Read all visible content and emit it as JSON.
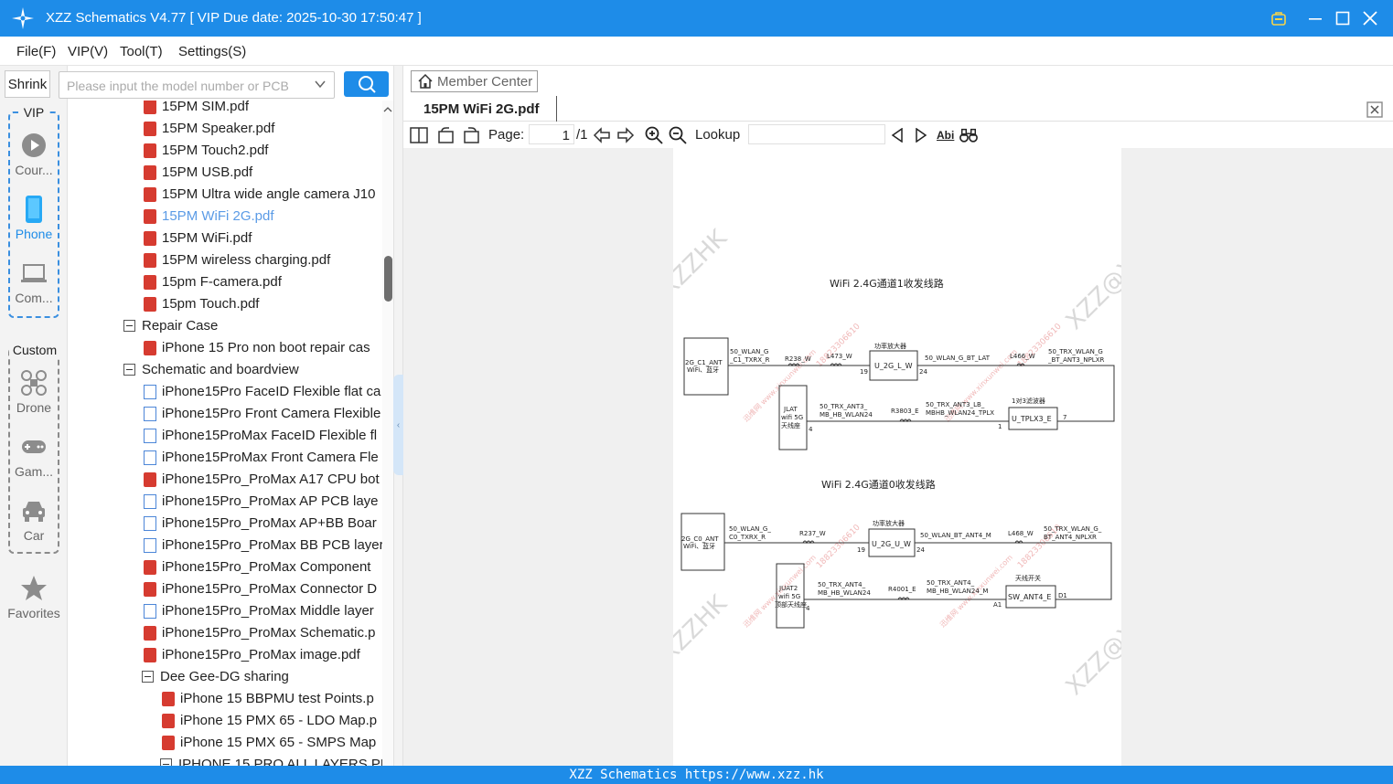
{
  "window": {
    "title": "XZZ Schematics V4.77 [ VIP Due date: 2025-10-30 17:50:47 ]",
    "icons": [
      "logo-icon",
      "vip-badge-icon",
      "minimize-icon",
      "maximize-icon",
      "close-icon"
    ]
  },
  "menu": [
    "File(F)",
    "VIP(V)",
    "Tool(T)",
    "Settings(S)"
  ],
  "sidebar": {
    "shrink_label": "Shrink",
    "vip_label": "VIP",
    "custom_label": "Custom",
    "vip_items": [
      {
        "label": "Cour...",
        "icon": "play-icon"
      },
      {
        "label": "Phone",
        "icon": "phone-icon"
      },
      {
        "label": "Com...",
        "icon": "laptop-icon"
      }
    ],
    "custom_items": [
      {
        "label": "Drone",
        "icon": "drone-icon"
      },
      {
        "label": "Gam...",
        "icon": "gamepad-icon"
      },
      {
        "label": "Car",
        "icon": "car-icon"
      }
    ],
    "favorites_label": "Favorites"
  },
  "search": {
    "placeholder": "Please input the model number or PCB"
  },
  "tree": [
    {
      "text": "15PM SIM.pdf",
      "type": "pdf",
      "indent": 1
    },
    {
      "text": "15PM Speaker.pdf",
      "type": "pdf",
      "indent": 1
    },
    {
      "text": "15PM Touch2.pdf",
      "type": "pdf",
      "indent": 1
    },
    {
      "text": "15PM USB.pdf",
      "type": "pdf",
      "indent": 1
    },
    {
      "text": "15PM Ultra wide angle camera J10",
      "type": "pdf",
      "indent": 1
    },
    {
      "text": "15PM WiFi 2G.pdf",
      "type": "pdf",
      "indent": 1,
      "selected": true
    },
    {
      "text": "15PM WiFi.pdf",
      "type": "pdf",
      "indent": 1
    },
    {
      "text": "15PM wireless charging.pdf",
      "type": "pdf",
      "indent": 1
    },
    {
      "text": "15pm F-camera.pdf",
      "type": "pdf",
      "indent": 1
    },
    {
      "text": "15pm Touch.pdf",
      "type": "pdf",
      "indent": 1
    },
    {
      "text": "Repair Case",
      "type": "folder",
      "indent": 0
    },
    {
      "text": "iPhone 15 Pro non boot repair cas",
      "type": "pdf",
      "indent": 1
    },
    {
      "text": "Schematic and boardview",
      "type": "folder",
      "indent": 0
    },
    {
      "text": "iPhone15Pro FaceID Flexible flat ca",
      "type": "doc",
      "indent": 1
    },
    {
      "text": "iPhone15Pro Front Camera Flexible",
      "type": "doc",
      "indent": 1
    },
    {
      "text": "iPhone15ProMax FaceID Flexible fl",
      "type": "doc",
      "indent": 1
    },
    {
      "text": "iPhone15ProMax Front Camera Fle",
      "type": "doc",
      "indent": 1
    },
    {
      "text": "iPhone15Pro_ProMax A17 CPU bot",
      "type": "pdf",
      "indent": 1
    },
    {
      "text": "iPhone15Pro_ProMax AP PCB laye",
      "type": "doc",
      "indent": 1
    },
    {
      "text": "iPhone15Pro_ProMax AP+BB Boar",
      "type": "doc",
      "indent": 1
    },
    {
      "text": "iPhone15Pro_ProMax BB PCB layer",
      "type": "doc",
      "indent": 1
    },
    {
      "text": "iPhone15Pro_ProMax Component",
      "type": "pdf",
      "indent": 1
    },
    {
      "text": "iPhone15Pro_ProMax Connector D",
      "type": "pdf",
      "indent": 1
    },
    {
      "text": "iPhone15Pro_ProMax Middle layer",
      "type": "doc",
      "indent": 1
    },
    {
      "text": "iPhone15Pro_ProMax Schematic.p",
      "type": "pdf",
      "indent": 1
    },
    {
      "text": "iPhone15Pro_ProMax image.pdf",
      "type": "pdf",
      "indent": 1
    },
    {
      "text": "Dee Gee-DG sharing",
      "type": "folder",
      "indent": 1
    },
    {
      "text": "iPhone 15 BBPMU test Points.p",
      "type": "pdf",
      "indent": 2
    },
    {
      "text": "iPhone 15 PMX 65 - LDO Map.p",
      "type": "pdf",
      "indent": 2
    },
    {
      "text": "iPhone 15 PMX 65 - SMPS Map",
      "type": "pdf",
      "indent": 2
    },
    {
      "text": "IPHONE 15 PRO ALL LAYERS PL",
      "type": "folder",
      "indent": 2
    }
  ],
  "viewer": {
    "member_center": "Member Center",
    "tab_title": "15PM WiFi 2G.pdf",
    "page_label": "Page:",
    "page_current": "1",
    "page_total": "/1",
    "lookup_label": "Lookup",
    "abi_label": "Abi"
  },
  "schematic": {
    "title1": "WiFi 2.4G通道1收发线路",
    "title2": "WiFi 2.4G通道0收发线路",
    "c1": {
      "ant_box": [
        "2G_C1_ANT",
        "WiFi、蓝牙"
      ],
      "net1": [
        "50_WLAN_G",
        "_C1_TXRX_R"
      ],
      "r1": "R238_W",
      "l1": "L473_W",
      "pa_label": "功率放大器",
      "pa": "U_2G_L_W",
      "pin19": "19",
      "pin24": "24",
      "net2": "50_WLAN_G_BT_LAT",
      "l2": "L466_W",
      "net3": [
        "50_TRX_WLAN_G",
        "_BT_ANT3_NPLXR"
      ],
      "conn": [
        "JLAT",
        "wifi 5G",
        "天线座"
      ],
      "pin4": "4",
      "net4": [
        "50_TRX_ANT3_",
        "MB_HB_WLAN24"
      ],
      "r2": "R3803_E",
      "net5": [
        "50_TRX_ANT3_LB_",
        "MBHB_WLAN24_TPLX"
      ],
      "filt_label": "1对3滤波器",
      "filt": "U_TPLX3_E",
      "pin1": "1",
      "pin7": "7"
    },
    "c0": {
      "ant_box": [
        "2G_C0_ANT",
        "WiFi、蓝牙"
      ],
      "net1": [
        "50_WLAN_G_",
        "C0_TXRX_R"
      ],
      "r1": "R237_W",
      "pa_label": "功率放大器",
      "pa": "U_2G_U_W",
      "pin19": "19",
      "pin24": "24",
      "net2": "50_WLAN_BT_ANT4_M",
      "l2": "L468_W",
      "net3": [
        "50_TRX_WLAN_G_",
        "BT_ANT4_NPLXR"
      ],
      "conn": [
        "JUAT2",
        "wifi 5G",
        "顶部天线座"
      ],
      "pin4": "4",
      "net4": [
        "50_TRX_ANT4_",
        "MB_HB_WLAN24"
      ],
      "r2": "R4001_E",
      "net5": [
        "50_TRX_ANT4_",
        "MB_HB_WLAN24_M"
      ],
      "sw_label": "天线开关",
      "sw": "SW_ANT4_E",
      "pinA1": "A1",
      "pinD1": "D1"
    },
    "watermark": "XZZ@XZZHK",
    "watermark_small": [
      "迅维网 www.xinxunwei.com",
      "18823306610"
    ]
  },
  "status": "XZZ Schematics https://www.xzz.hk",
  "colors": {
    "accent": "#1e8ce8",
    "pdf": "#d63b30",
    "selected": "#5b9be6"
  }
}
